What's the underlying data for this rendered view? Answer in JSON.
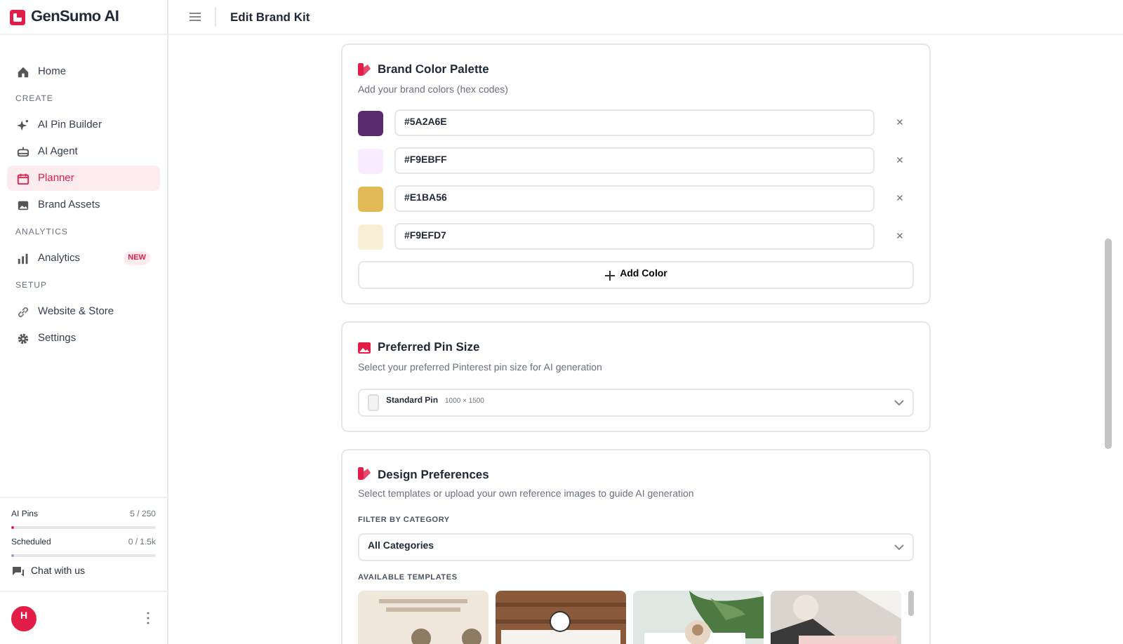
{
  "brand": {
    "name": "GenSumo AI"
  },
  "header": {
    "title": "Edit Brand Kit"
  },
  "sidebar": {
    "items": [
      {
        "kind": "item",
        "label": "Home",
        "selected": false
      },
      {
        "kind": "section",
        "label": "CREATE"
      },
      {
        "kind": "item",
        "label": "AI Pin Builder",
        "selected": false
      },
      {
        "kind": "item",
        "label": "AI Agent",
        "selected": false
      },
      {
        "kind": "item",
        "label": "Planner",
        "selected": true
      },
      {
        "kind": "item",
        "label": "Brand Assets",
        "selected": false
      },
      {
        "kind": "section",
        "label": "ANALYTICS"
      },
      {
        "kind": "item",
        "label": "Analytics",
        "selected": false,
        "badge": "NEW"
      },
      {
        "kind": "section",
        "label": "SETUP"
      },
      {
        "kind": "item",
        "label": "Website & Store",
        "selected": false
      },
      {
        "kind": "item",
        "label": "Settings",
        "selected": false
      }
    ],
    "usage": [
      {
        "label": "AI Pins",
        "reading": "5 / 250",
        "level": 0.02
      },
      {
        "label": "Scheduled",
        "reading": "0 / 1.5k",
        "level": 0.01
      }
    ],
    "chat": "Chat with us",
    "avatar": "H"
  },
  "palette": {
    "title": "Brand Color Palette",
    "subtitle": "Add your brand colors (hex codes)",
    "colors": [
      {
        "value": "#5A2A6E",
        "color": "#5a2a6e"
      },
      {
        "value": "#F9EBFF",
        "color": "#f9ebff"
      },
      {
        "value": "#E1BA56",
        "color": "#e1ba56"
      },
      {
        "value": "#F9EFD7",
        "color": "#f9efd7"
      }
    ],
    "remove": "×",
    "add_button": "Add Color"
  },
  "pin_size": {
    "title": "Preferred Pin Size",
    "subtitle": "Select your preferred Pinterest pin size for AI generation",
    "value": "Standard Pin",
    "dimensions": "1000 × 1500"
  },
  "design": {
    "title": "Design Preferences",
    "subtitle": "Select templates or upload your own reference images to guide AI generation",
    "filter_label": "FILTER BY CATEGORY",
    "filter_value": "All Categories",
    "templates_label": "AVAILABLE TEMPLATES"
  }
}
